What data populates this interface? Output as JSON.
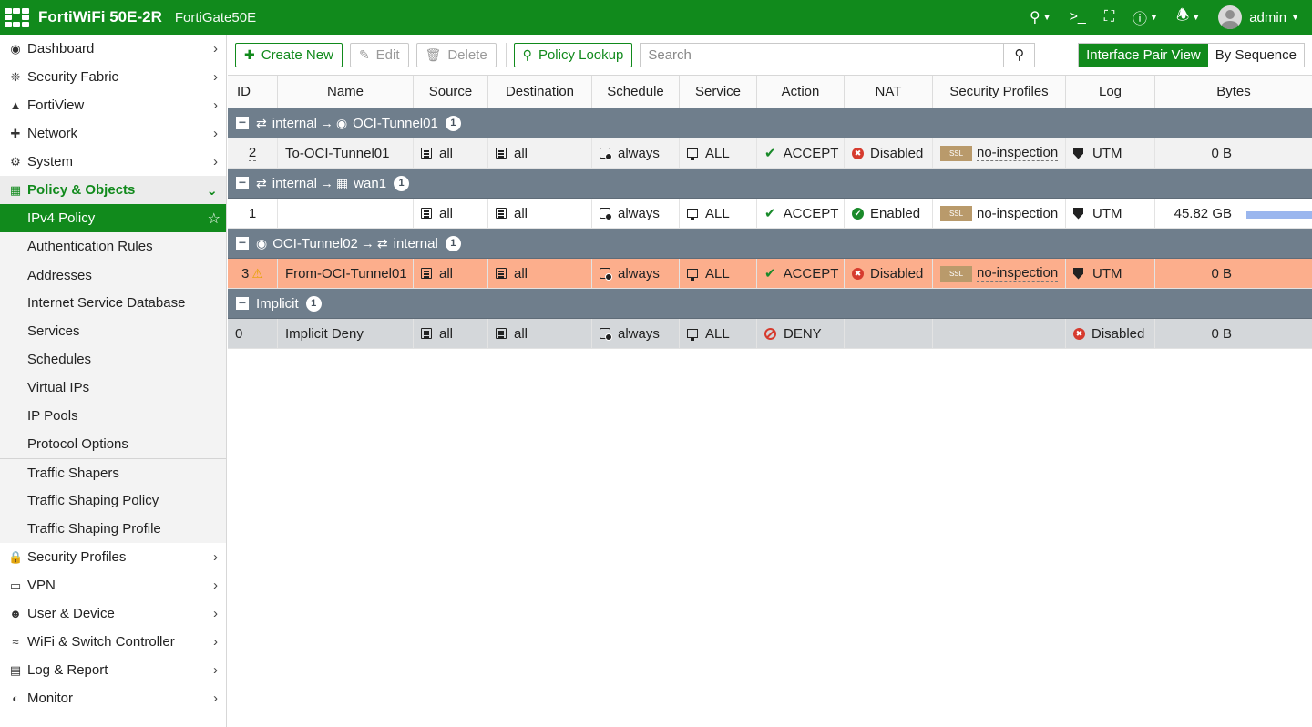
{
  "topbar": {
    "brand": "FortiWiFi 50E-2R",
    "hostname": "FortiGate50E",
    "username": "admin"
  },
  "sidebar": {
    "items": [
      {
        "label": "Dashboard",
        "icon": "dashboard-icon"
      },
      {
        "label": "Security Fabric",
        "icon": "security-fabric-icon"
      },
      {
        "label": "FortiView",
        "icon": "fortiview-icon"
      },
      {
        "label": "Network",
        "icon": "network-icon"
      },
      {
        "label": "System",
        "icon": "gear-icon"
      },
      {
        "label": "Policy & Objects",
        "icon": "policy-icon"
      },
      {
        "label": "Security Profiles",
        "icon": "lock-icon"
      },
      {
        "label": "VPN",
        "icon": "laptop-icon"
      },
      {
        "label": "User & Device",
        "icon": "user-icon"
      },
      {
        "label": "WiFi & Switch Controller",
        "icon": "wifi-icon"
      },
      {
        "label": "Log & Report",
        "icon": "chart-icon"
      },
      {
        "label": "Monitor",
        "icon": "pie-icon"
      }
    ],
    "policy_sub": [
      "IPv4 Policy",
      "Authentication Rules",
      "Addresses",
      "Internet Service Database",
      "Services",
      "Schedules",
      "Virtual IPs",
      "IP Pools",
      "Protocol Options",
      "Traffic Shapers",
      "Traffic Shaping Policy",
      "Traffic Shaping Profile"
    ]
  },
  "toolbar": {
    "create_new": "Create New",
    "edit": "Edit",
    "delete": "Delete",
    "policy_lookup": "Policy Lookup",
    "search_placeholder": "Search",
    "view_interface_pair": "Interface Pair View",
    "view_by_sequence": "By Sequence"
  },
  "table": {
    "columns": [
      "ID",
      "Name",
      "Source",
      "Destination",
      "Schedule",
      "Service",
      "Action",
      "NAT",
      "Security Profiles",
      "Log",
      "Bytes"
    ],
    "groups": [
      {
        "from": "internal",
        "to": "OCI-Tunnel01",
        "count": "1",
        "rows": [
          {
            "id": "2",
            "name": "To-OCI-Tunnel01",
            "source": "all",
            "destination": "all",
            "schedule": "always",
            "service": "ALL",
            "action": "ACCEPT",
            "nat": "Disabled",
            "profile_badge": "SSL",
            "profile": "no-inspection",
            "log": "UTM",
            "bytes": "0 B"
          }
        ]
      },
      {
        "from": "internal",
        "to": "wan1",
        "count": "1",
        "rows": [
          {
            "id": "1",
            "name": "",
            "source": "all",
            "destination": "all",
            "schedule": "always",
            "service": "ALL",
            "action": "ACCEPT",
            "nat": "Enabled",
            "profile_badge": "SSL",
            "profile": "no-inspection",
            "log": "UTM",
            "bytes": "45.82 GB",
            "usage_fraction": 0.9
          }
        ]
      },
      {
        "from": "OCI-Tunnel02",
        "to": "internal",
        "count": "1",
        "rows": [
          {
            "id": "3",
            "name": "From-OCI-Tunnel01",
            "source": "all",
            "destination": "all",
            "schedule": "always",
            "service": "ALL",
            "action": "ACCEPT",
            "nat": "Disabled",
            "profile_badge": "SSL",
            "profile": "no-inspection",
            "log": "UTM",
            "bytes": "0 B"
          }
        ]
      },
      {
        "label": "Implicit",
        "count": "1",
        "rows": [
          {
            "id": "0",
            "name": "Implicit Deny",
            "source": "all",
            "destination": "all",
            "schedule": "always",
            "service": "ALL",
            "action": "DENY",
            "log": "Disabled",
            "bytes": "0 B"
          }
        ]
      }
    ]
  },
  "colors": {
    "brand_green": "#118a1c",
    "group_header": "#6f7e8c",
    "warning_row": "#fcae8c",
    "usage_bar": "#9ab6ee"
  }
}
